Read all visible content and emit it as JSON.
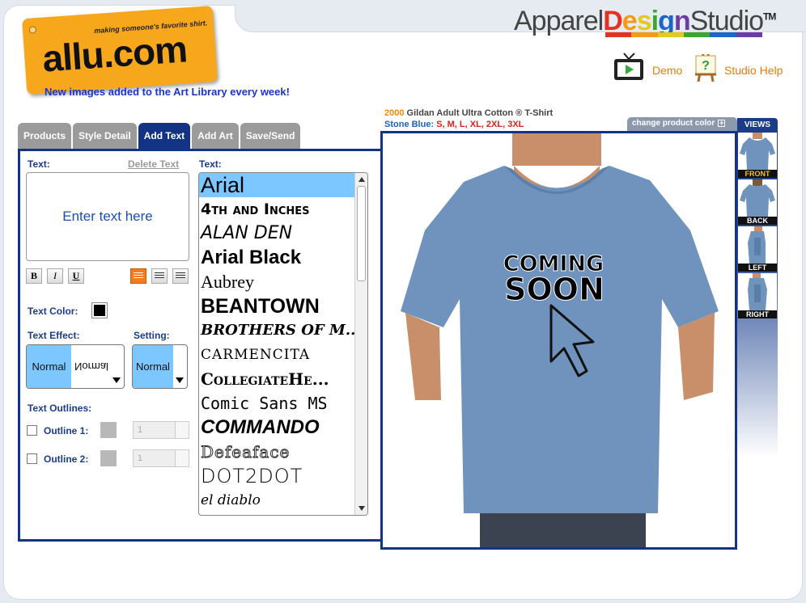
{
  "logo": {
    "tagline": "making someone's favorite shirt.",
    "wordmark": "allu.com"
  },
  "announcement": "New images added to the Art Library every week!",
  "brand": {
    "pre": "Apparel",
    "design_letters": [
      "D",
      "e",
      "s",
      "i",
      "g",
      "n"
    ],
    "post": "Studio",
    "tm": "TM"
  },
  "header_links": {
    "demo": "Demo",
    "help": "Studio Help"
  },
  "tabs": [
    "Products",
    "Style Detail",
    "Add Text",
    "Add Art",
    "Save/Send"
  ],
  "active_tab": "Add Text",
  "text_panel": {
    "text_label": "Text:",
    "delete_text": "Delete Text",
    "textbox_value": "Enter text here",
    "format_buttons": {
      "bold": "B",
      "italic": "I",
      "underline": "U"
    },
    "text_color_label": "Text Color:",
    "text_color": "#000000",
    "text_effect_label": "Text Effect:",
    "effect_selected": "Normal",
    "effect_alt": "Normal",
    "setting_label": "Setting:",
    "setting_selected": "Normal",
    "outlines_label": "Text Outlines:",
    "outline1_label": "Outline 1:",
    "outline2_label": "Outline 2:",
    "outline1_value": "1",
    "outline2_value": "1"
  },
  "font_list": {
    "label": "Text:",
    "fonts": [
      "Arial",
      "4th and Inches",
      "Alan Den",
      "Arial Black",
      "Aubrey",
      "BEANTOWN",
      "BROTHERS OF M...",
      "CARMENCITA",
      "CollegiateHe...",
      "Comic Sans MS",
      "COMMANDO",
      "Defeaface",
      "DOT2DOT",
      "el diablo"
    ],
    "selected": "Arial"
  },
  "product": {
    "style_number": "2000",
    "name": "Gildan Adult Ultra Cotton ® T-Shirt",
    "color": "Stone Blue:",
    "sizes": "S, M, L, XL, 2XL, 3XL",
    "change_color": "change product color",
    "shirt_color": "#6f93bd"
  },
  "design": {
    "line1": "COMING",
    "line2": "SOON"
  },
  "views": {
    "title": "VIEWS",
    "items": [
      "FRONT",
      "BACK",
      "LEFT",
      "RIGHT"
    ],
    "active": "FRONT"
  }
}
